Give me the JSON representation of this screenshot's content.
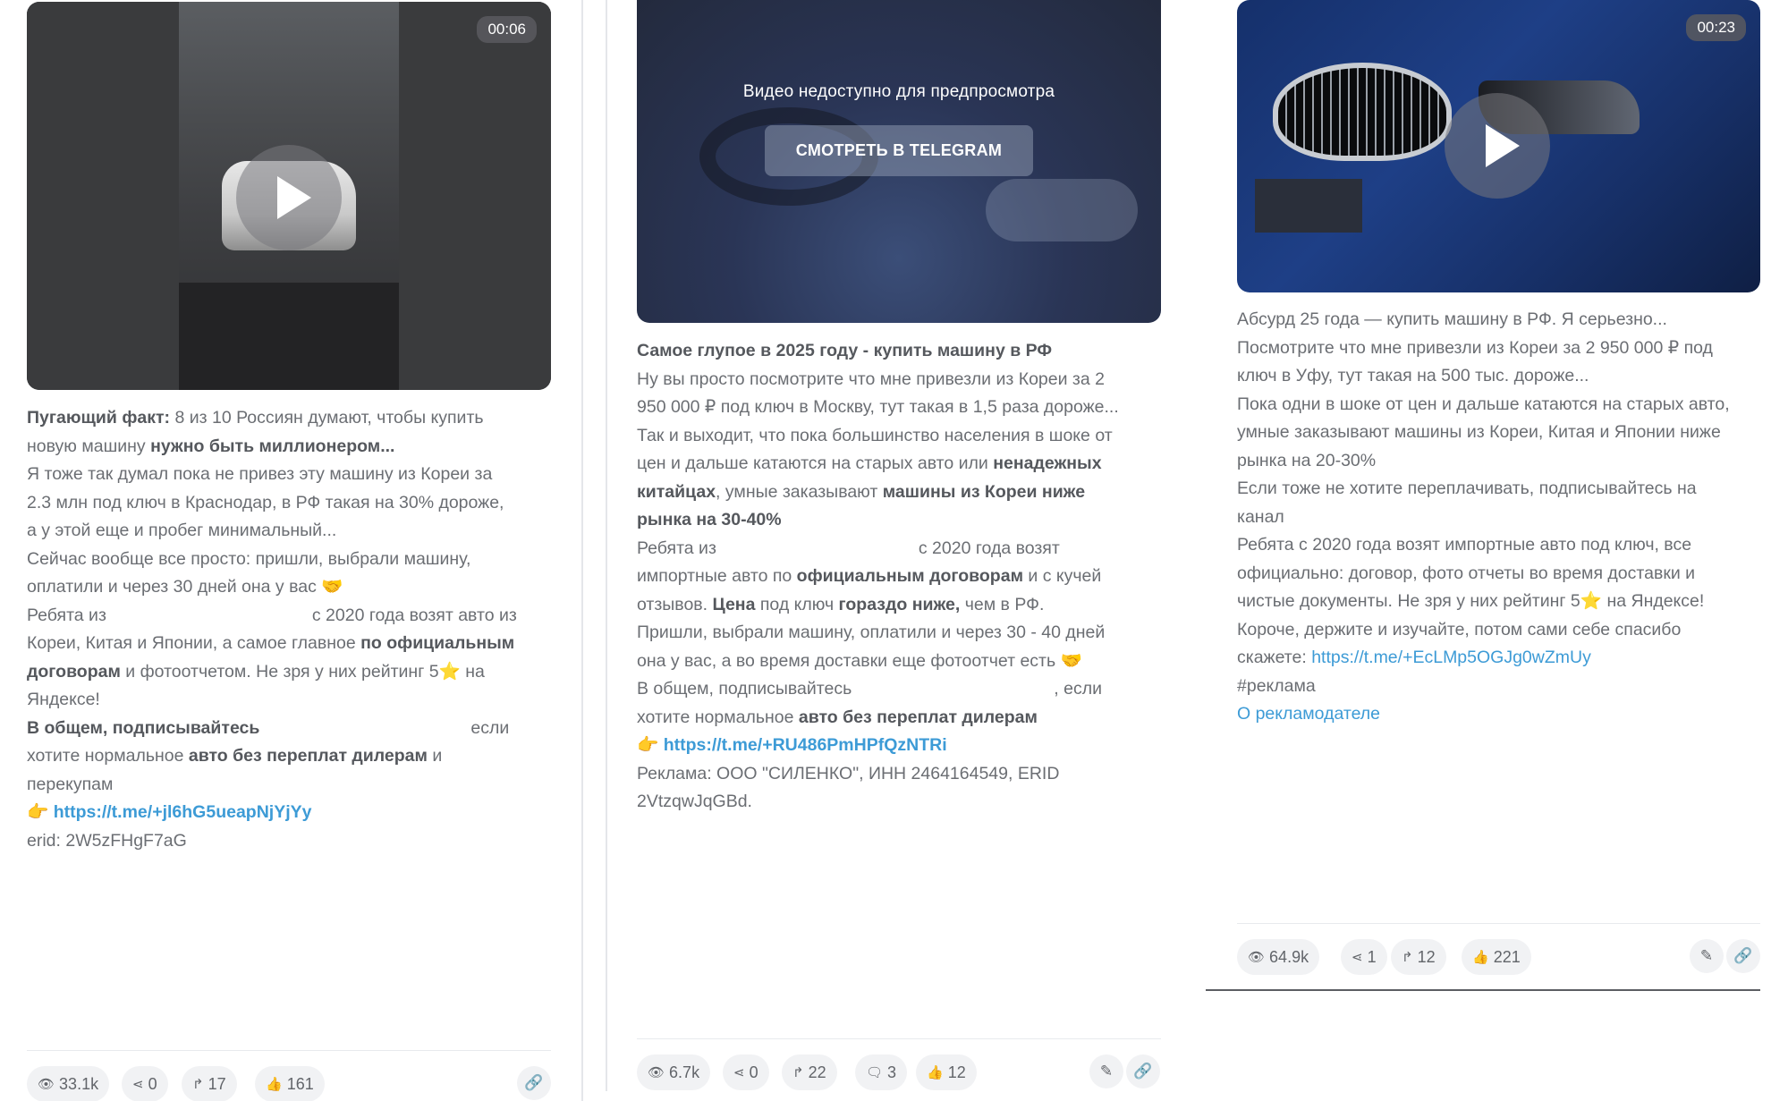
{
  "colors": {
    "link": "#3d9bd6",
    "text": "#6b6e73",
    "chip_bg": "#f1f2f4"
  },
  "posts": [
    {
      "duration": "00:06",
      "lines": [
        {
          "b1": "Пугающий факт:",
          "t1": " 8 из 10 Россиян думают, чтобы купить"
        },
        {
          "t1": "новую машину ",
          "b1": "нужно быть миллионером..."
        },
        {
          "t1": "Я тоже так думал пока не привез эту машину из Кореи за"
        },
        {
          "t1": "2.3 млн под ключ в Краснодар, в РФ такая на 30% дороже,"
        },
        {
          "t1": "а у этой еще и пробег минимальный..."
        },
        {
          "t1": "Сейчас вообще все просто: пришли, выбрали машину,"
        },
        {
          "t1": "оплатили и через 30 дней она у вас 🤝"
        },
        {
          "t1": "Ребята из",
          "t2": "с 2020 года возят авто из"
        },
        {
          "t1": "Кореи, Китая и Японии, а самое главное ",
          "b1": "по официальным"
        },
        {
          "b1": "договорам",
          "t1": " и фотоотчетом. Не зря у них рейтинг 5⭐ на"
        },
        {
          "t1": "Яндексе!"
        },
        {
          "b1": "В общем, подписывайтесь",
          "t2": "если"
        },
        {
          "t1": "хотите нормальное ",
          "b1": "авто без переплат дилерам",
          "t3": " и"
        },
        {
          "t1": "перекупам"
        },
        {
          "emoji": "👉",
          "link": "https://t.me/+jl6hG5ueapNjYjYy"
        },
        {
          "t1": "erid: 2W5zFHgF7aG"
        }
      ],
      "stats": {
        "views": "33.1k",
        "shares": "0",
        "forwards": "17",
        "likes": "161"
      }
    },
    {
      "overlay_title": "Видео недоступно для предпросмотра",
      "overlay_button": "СМОТРЕТЬ В TELEGRAM",
      "lines": [
        {
          "b1": "Самое глупое в 2025 году - купить машину в РФ"
        },
        {
          "t1": "Ну вы просто посмотрите что мне привезли из Кореи за 2"
        },
        {
          "t1": "950 000 ₽ под ключ в Москву, тут такая в 1,5 раза дороже..."
        },
        {
          "t1": "Так и выходит, что пока большинство населения в шоке от"
        },
        {
          "t1": "цен и дальше катаются на старых авто или ",
          "b1": "ненадежных"
        },
        {
          "b1": "китайцах",
          "t1": ", умные заказывают ",
          "b2": "машины из Кореи ниже"
        },
        {
          "b1": "рынка на 30-40%"
        },
        {
          "t1": "Ребята из",
          "t2": "с 2020 года возят"
        },
        {
          "t1": "импортные авто по ",
          "b1": "официальным договорам",
          "t3": " и с кучей"
        },
        {
          "t1": "отзывов. ",
          "b1": "Цена",
          "t3": " под ключ ",
          "b2": "гораздо ниже,",
          "t4": " чем в РФ."
        },
        {
          "t1": "Пришли, выбрали машину, оплатили и через 30 - 40 дней"
        },
        {
          "t1": "она у вас, а во время доставки еще фотоотчет есть 🤝"
        },
        {
          "t1": "В общем, подписывайтесь",
          "t2": ", если"
        },
        {
          "t1": "хотите нормальное ",
          "b1": "авто без переплат дилерам"
        },
        {
          "emoji": "👉",
          "link": "https://t.me/+RU486PmHPfQzNTRi"
        },
        {
          "t1": "Реклама: ООО \"СИЛЕНКО\", ИНН 2464164549, ERID"
        },
        {
          "t1": "2VtzqwJqGBd."
        }
      ],
      "stats": {
        "views": "6.7k",
        "shares": "0",
        "forwards": "22",
        "comments": "3",
        "likes": "12"
      }
    },
    {
      "duration": "00:23",
      "lines": [
        {
          "t1": "Абсурд 25 года — купить машину в РФ. Я серьезно..."
        },
        {
          "t1": "Посмотрите что мне привезли из Кореи за 2 950 000 ₽ под"
        },
        {
          "t1": "ключ в Уфу, тут такая на 500 тыс. дороже..."
        },
        {
          "t1": "Пока одни в шоке от цен и дальше катаются на старых авто,"
        },
        {
          "t1": "умные заказывают машины из Кореи, Китая и Японии ниже"
        },
        {
          "t1": "рынка на 20-30%"
        },
        {
          "t1": "Если тоже не хотите переплачивать, подписывайтесь на"
        },
        {
          "t1": "канал"
        },
        {
          "t1": "Ребята с 2020 года возят импортные авто под ключ, все"
        },
        {
          "t1": "официально: договор, фото отчеты во время доставки и"
        },
        {
          "t1": "чистые документы. Не зря у них рейтинг 5⭐ на Яндексе!"
        },
        {
          "t1": "Короче, держите и изучайте, потом сами себе спасибо"
        },
        {
          "t1": "скажете: ",
          "link": "https://t.me/+EcLMp5OGJg0wZmUy"
        },
        {
          "t1": "#реклама"
        },
        {
          "link": "О рекламодателе"
        }
      ],
      "stats": {
        "views": "64.9k",
        "shares": "1",
        "forwards": "12",
        "likes": "221"
      }
    }
  ],
  "icons": {
    "views": "eye-icon",
    "shares": "share-icon",
    "forwards": "forward-icon",
    "comments": "comments-icon",
    "likes": "thumbs-up-icon",
    "edit": "pencil-icon",
    "link": "link-icon",
    "play": "play-icon"
  }
}
